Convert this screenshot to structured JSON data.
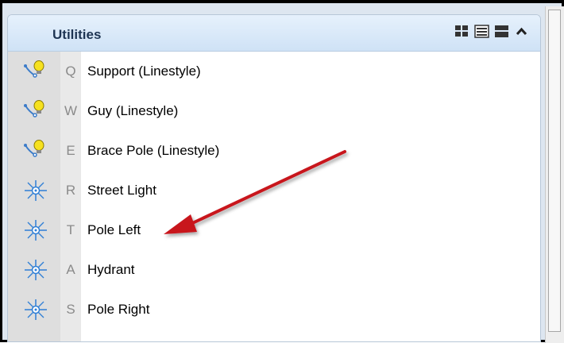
{
  "panel": {
    "title": "Utilities",
    "header_icons": [
      "large-icons-view-icon",
      "list-view-icon",
      "detail-view-icon",
      "collapse-chevron-icon"
    ]
  },
  "tools": [
    {
      "key": "Q",
      "label": "Support (Linestyle)",
      "icon": "linestyle-bulb-icon"
    },
    {
      "key": "W",
      "label": "Guy (Linestyle)",
      "icon": "linestyle-bulb-icon"
    },
    {
      "key": "E",
      "label": "Brace Pole (Linestyle)",
      "icon": "linestyle-bulb-icon"
    },
    {
      "key": "R",
      "label": "Street Light",
      "icon": "cell-placement-icon"
    },
    {
      "key": "T",
      "label": "Pole Left",
      "icon": "cell-placement-icon"
    },
    {
      "key": "A",
      "label": "Hydrant",
      "icon": "cell-placement-icon"
    },
    {
      "key": "S",
      "label": "Pole Right",
      "icon": "cell-placement-icon"
    }
  ],
  "colors": {
    "arrow": "#c8141e",
    "header": "#cfe2f6",
    "title": "#1e3553",
    "cell_icon": "#2f7fd6"
  }
}
